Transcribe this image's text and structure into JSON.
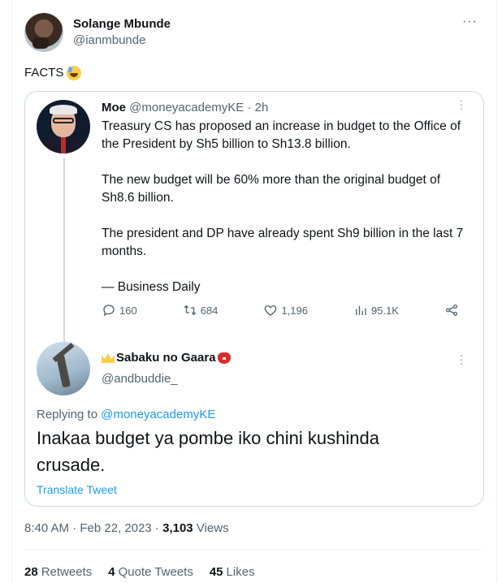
{
  "author": {
    "name": "Solange Mbunde",
    "handle": "@ianmbunde",
    "more": "···"
  },
  "tweet_text": "FACTS",
  "quoted": {
    "name": "Moe",
    "handle_time": "@moneyacademyKE · 2h",
    "paragraphs": [
      "Treasury CS has proposed an increase in budget to the Office of the President by Sh5 billion to Sh13.8 billion.",
      "The new budget will be 60% more than the original budget of Sh8.6 billion.",
      "The president and DP have already spent Sh9 billion in the last 7 months.",
      "— Business Daily"
    ],
    "actions": {
      "replies": "160",
      "retweets": "684",
      "likes": "1,196",
      "views": "95.1K"
    }
  },
  "reply": {
    "name": "Sabaku no Gaara",
    "handle": "@andbuddie_",
    "replying_prefix": "Replying to",
    "replying_to": "@moneyacademyKE",
    "text": "Inakaa budget ya pombe iko chini kushinda crusade.",
    "translate": "Translate Tweet"
  },
  "meta": {
    "time_date": "8:40 AM · Feb 22, 2023 · ",
    "views_count": "3,103",
    "views_label": "Views"
  },
  "stats": {
    "retweets_count": "28",
    "retweets_label": "Retweets",
    "quotes_count": "4",
    "quotes_label": "Quote Tweets",
    "likes_count": "45",
    "likes_label": "Likes"
  },
  "colors": {
    "link": "#1d9bf0",
    "secondary_text": "#536471",
    "primary_text": "#0f1419"
  }
}
